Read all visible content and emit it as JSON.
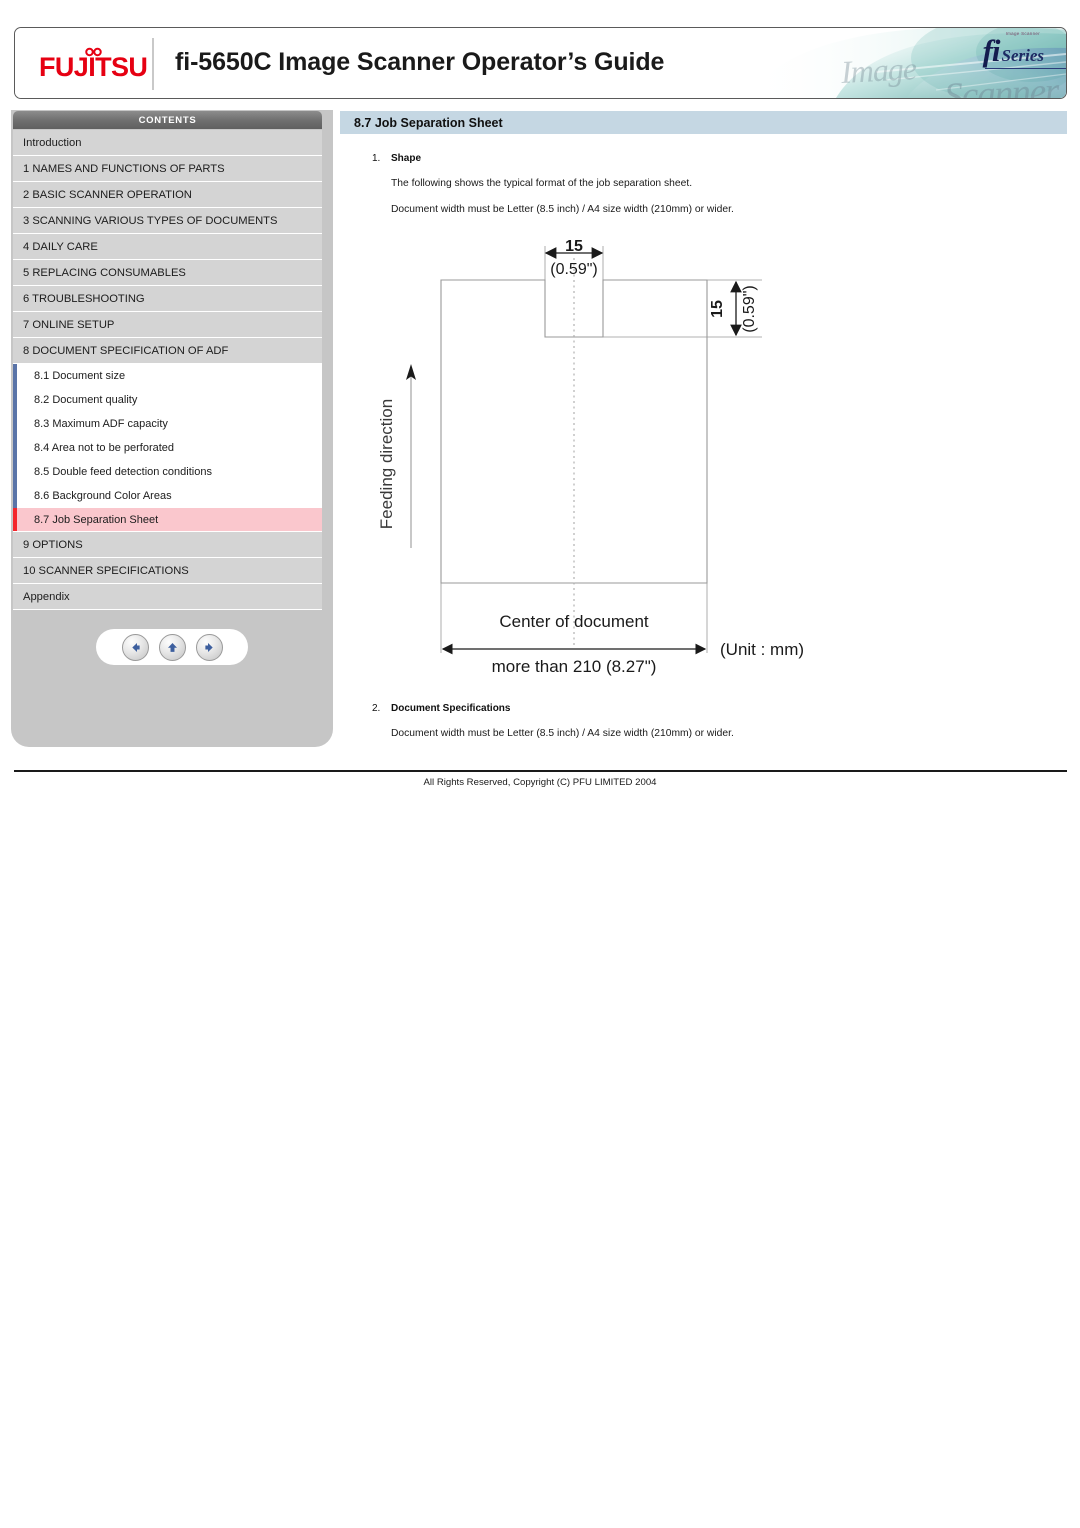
{
  "header": {
    "brand": "FUJITSU",
    "title": "fi-5650C Image Scanner Operator’s Guide",
    "series_logo": {
      "glyph": "fi",
      "word": "Series",
      "tiny": "Image Scanner",
      "watermark_1": "Image",
      "watermark_2": "Scanner"
    }
  },
  "sidebar": {
    "contents_label": "CONTENTS",
    "items": [
      {
        "label": "Introduction",
        "level": "top",
        "selected": false
      },
      {
        "label": "1 NAMES AND FUNCTIONS OF PARTS",
        "level": "top",
        "selected": false
      },
      {
        "label": "2 BASIC SCANNER OPERATION",
        "level": "top",
        "selected": false
      },
      {
        "label": "3 SCANNING VARIOUS TYPES OF DOCUMENTS",
        "level": "top",
        "selected": false
      },
      {
        "label": "4 DAILY CARE",
        "level": "top",
        "selected": false
      },
      {
        "label": "5 REPLACING CONSUMABLES",
        "level": "top",
        "selected": false
      },
      {
        "label": "6 TROUBLESHOOTING",
        "level": "top",
        "selected": false
      },
      {
        "label": "7 ONLINE SETUP",
        "level": "top",
        "selected": false
      },
      {
        "label": "8 DOCUMENT SPECIFICATION OF ADF",
        "level": "top",
        "selected": false
      },
      {
        "label": "8.1 Document size",
        "level": "sub",
        "selected": false
      },
      {
        "label": "8.2 Document quality",
        "level": "sub",
        "selected": false
      },
      {
        "label": "8.3 Maximum ADF capacity",
        "level": "sub",
        "selected": false
      },
      {
        "label": "8.4 Area not to be perforated",
        "level": "sub",
        "selected": false
      },
      {
        "label": "8.5 Double feed detection conditions",
        "level": "sub",
        "selected": false
      },
      {
        "label": "8.6 Background Color Areas",
        "level": "sub",
        "selected": false
      },
      {
        "label": "8.7 Job Separation Sheet",
        "level": "sub",
        "selected": true
      },
      {
        "label": "9 OPTIONS",
        "level": "top",
        "selected": false
      },
      {
        "label": "10 SCANNER SPECIFICATIONS",
        "level": "top",
        "selected": false
      },
      {
        "label": "Appendix",
        "level": "top",
        "selected": false
      }
    ],
    "nav_buttons": [
      {
        "name": "back-button",
        "icon": "arrow-left-icon"
      },
      {
        "name": "up-button",
        "icon": "arrow-up-icon"
      },
      {
        "name": "forward-button",
        "icon": "arrow-right-icon"
      }
    ]
  },
  "main": {
    "heading": "8.7 Job Separation Sheet",
    "sections": [
      {
        "number": "1.",
        "title": "Shape",
        "paragraphs": [
          "The following shows the typical format of the job separation sheet.",
          "Document width must be Letter (8.5 inch) / A4 size width (210mm) or wider."
        ]
      },
      {
        "number": "2.",
        "title": "Document Specifications",
        "paragraphs": [
          "Document width must be Letter (8.5 inch) / A4 size width (210mm) or wider."
        ]
      }
    ],
    "diagram": {
      "notch_width_mm": "15",
      "notch_width_in": "(0.59\")",
      "notch_depth_mm": "15",
      "notch_depth_in": "(0.59\")",
      "feeding_direction_label": "Feeding direction",
      "center_label": "Center of document",
      "width_label": "more than 210 (8.27\")",
      "unit_label": "(Unit : mm)"
    }
  },
  "footer": {
    "copyright": "All Rights Reserved, Copyright (C) PFU LIMITED 2004"
  }
}
